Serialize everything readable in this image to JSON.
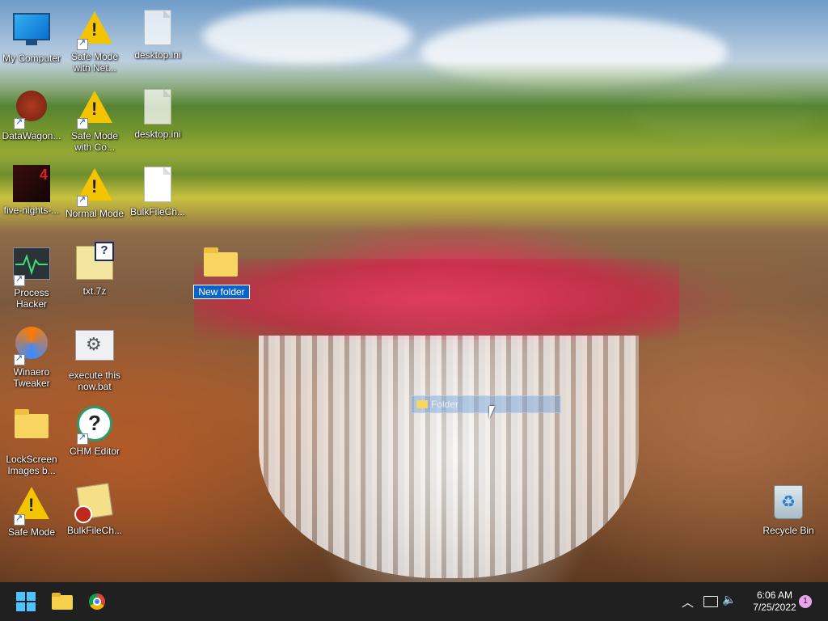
{
  "desktop": {
    "icons": [
      {
        "label": "My Computer"
      },
      {
        "label": "Safe Mode with Net..."
      },
      {
        "label": "desktop.ini"
      },
      {
        "label": "DataWagon..."
      },
      {
        "label": "Safe Mode with Co..."
      },
      {
        "label": "desktop.ini"
      },
      {
        "label": "five-nights-..."
      },
      {
        "label": "Normal Mode"
      },
      {
        "label": "BulkFileCh..."
      },
      {
        "label": "Process Hacker"
      },
      {
        "label": "txt.7z"
      },
      {
        "label": "New folder"
      },
      {
        "label": "Winaero Tweaker"
      },
      {
        "label": "execute this now.bat"
      },
      {
        "label": "LockScreen Images b..."
      },
      {
        "label": "CHM Editor"
      },
      {
        "label": "Safe Mode"
      },
      {
        "label": "BulkFileCh..."
      },
      {
        "label": "Recycle Bin"
      }
    ],
    "drag_ghost_label": "Folder",
    "txt7z_badge": "?",
    "five_nights_badge": "4"
  },
  "taskbar": {
    "time": "6:06 AM",
    "date": "7/25/2022",
    "notification_count": "1",
    "accent": "#4cc2ff",
    "background": "#202020"
  }
}
